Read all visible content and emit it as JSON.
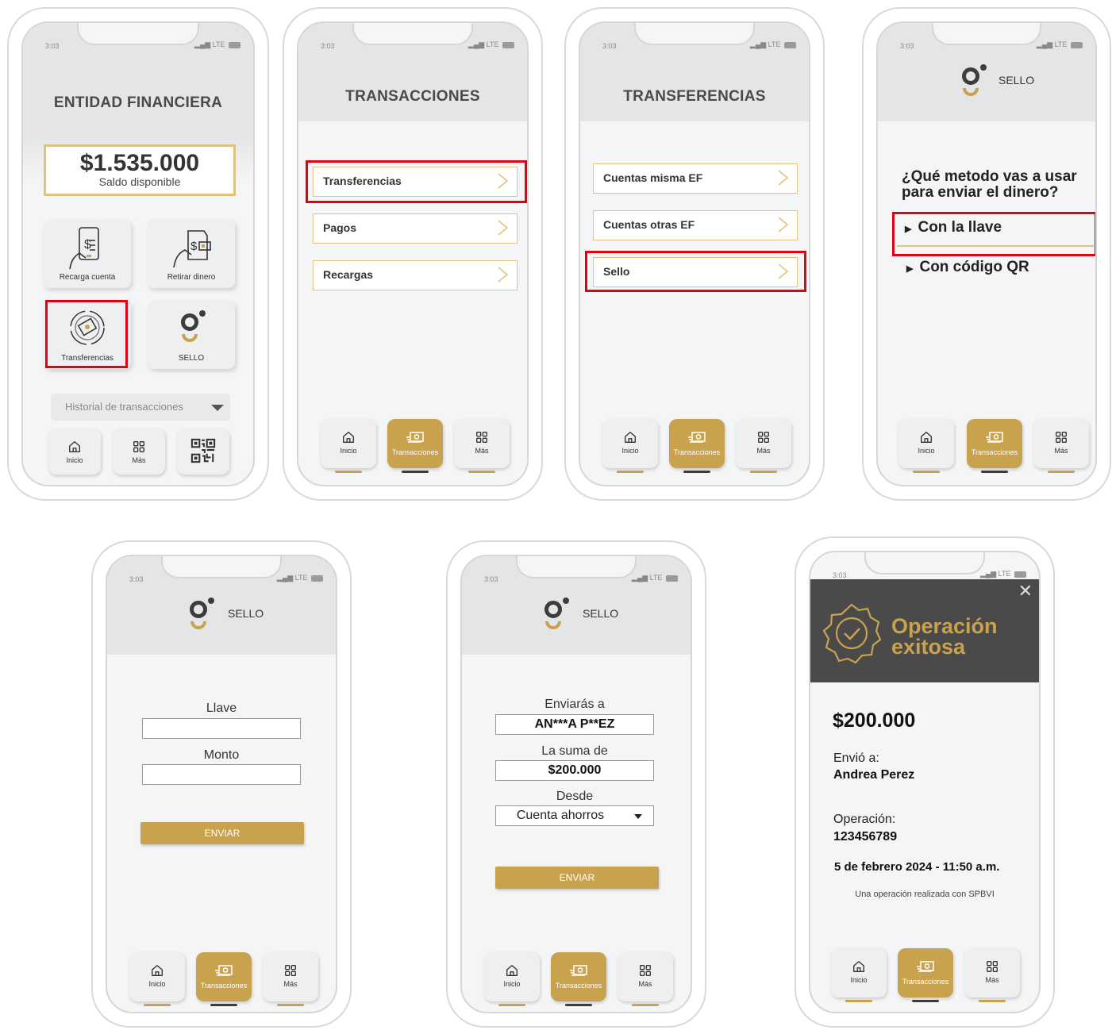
{
  "status_bar": {
    "time": "3:03",
    "network": "LTE"
  },
  "nav": {
    "home": "Inicio",
    "transactions": "Transacciones",
    "more": "Más"
  },
  "colors": {
    "gold": "#c9a24d",
    "gold_border": "#e2c27e",
    "highlight": "#e3000f",
    "dark_header": "#4a4a4a"
  },
  "screen1": {
    "title": "ENTIDAD FINANCIERA",
    "balance": "$1.535.000",
    "balance_label": "Saldo disponible",
    "tiles": [
      "Recarga cuenta",
      "Retirar dinero",
      "Transferencias",
      "SELLO"
    ],
    "history_select": "Historial de transacciones"
  },
  "screen2": {
    "title": "TRANSACCIONES",
    "items": [
      "Transferencias",
      "Pagos",
      "Recargas"
    ]
  },
  "screen3": {
    "title": "TRANSFERENCIAS",
    "items": [
      "Cuentas misma EF",
      "Cuentas otras EF",
      "Sello"
    ]
  },
  "screen4": {
    "logo_text": "SELLO",
    "question": "¿Qué metodo vas a usar para enviar el dinero?",
    "options": [
      "Con la llave",
      "Con código QR"
    ]
  },
  "screen5": {
    "logo_text": "SELLO",
    "key_label": "Llave",
    "amount_label": "Monto",
    "send": "ENVIAR"
  },
  "screen6": {
    "logo_text": "SELLO",
    "to_label": "Enviarás a",
    "to_value": "AN***A P**EZ",
    "sum_label": "La suma de",
    "sum_value": "$200.000",
    "from_label": "Desde",
    "from_value": "Cuenta ahorros",
    "send": "ENVIAR"
  },
  "screen7": {
    "success_title": "Operación exitosa",
    "amount": "$200.000",
    "sent_to_label": "Envió a:",
    "sent_to_value": "Andrea Perez",
    "operation_label": "Operación:",
    "operation_value": "123456789",
    "datetime": "5 de febrero 2024 - 11:50 a.m.",
    "footer": "Una operación realizada con SPBVI"
  }
}
